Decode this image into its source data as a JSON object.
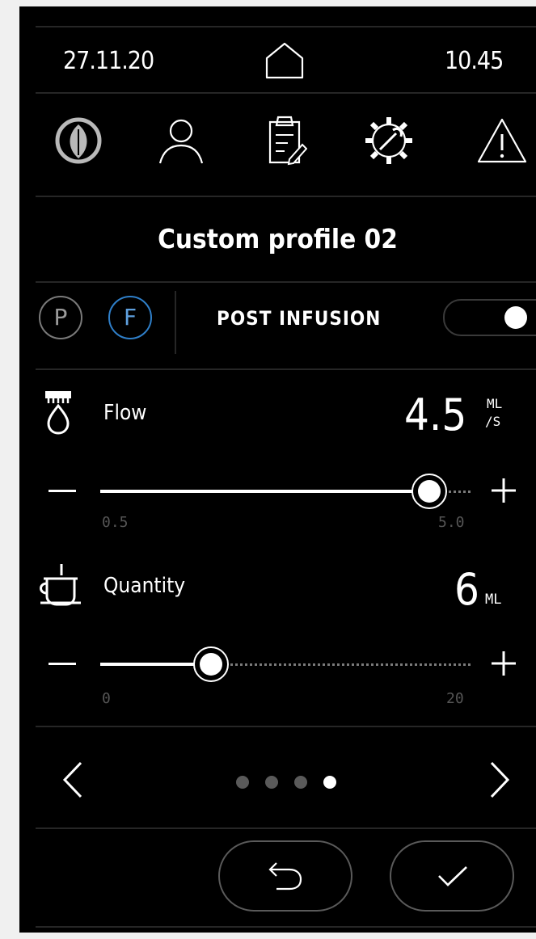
{
  "status": {
    "date": "27.11.20",
    "time": "10.45"
  },
  "icons": {
    "home": "home-icon",
    "nav": [
      "leaf-icon",
      "user-icon",
      "clipboard-icon",
      "gear-wrench-icon",
      "warning-icon"
    ]
  },
  "profile": {
    "title": "Custom profile 02"
  },
  "mode": {
    "p_label": "P",
    "f_label": "F",
    "selected": "F",
    "post_infusion_label": "POST INFUSION",
    "post_infusion_on": true
  },
  "flow": {
    "label": "Flow",
    "value": "4.5",
    "unit_top": "ML",
    "unit_bottom": "/S",
    "min": "0.5",
    "max": "5.0",
    "current": 4.5
  },
  "quantity": {
    "label": "Quantity",
    "value": "6",
    "unit": "ML",
    "min": "0",
    "max": "20",
    "current": 6
  },
  "pager": {
    "pages": 4,
    "active": 4
  },
  "colors": {
    "background": "#000000",
    "text": "#ffffff",
    "accent": "#2f7fc9",
    "divider": "#262626"
  }
}
